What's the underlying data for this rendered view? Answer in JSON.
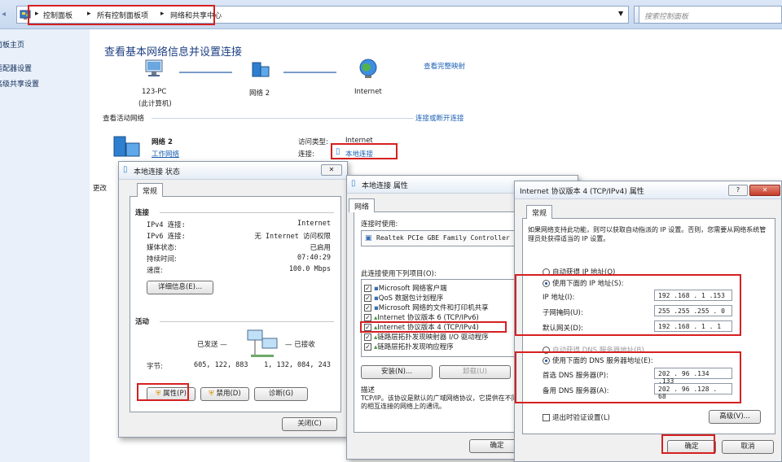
{
  "address_bar": {
    "crumbs": [
      "控制面板",
      "所有控制面板项",
      "网络和共享中心"
    ],
    "search_placeholder": "搜索控制面板"
  },
  "left_nav": [
    "控制面板主页",
    "更改适配器设置",
    "更改高级共享设置"
  ],
  "main": {
    "title": "查看基本网络信息并设置连接",
    "view_full_map": "查看完整映射",
    "node_pc": "123-PC",
    "node_pc_sub": "(此计算机)",
    "node_network": "网络  2",
    "node_internet": "Internet",
    "active_networks_label": "查看活动网络",
    "connect_disconnect": "连接或断开连接",
    "network_name": "网络  2",
    "network_type": "工作网络",
    "access_type_label": "访问类型:",
    "access_type_value": "Internet",
    "connection_label": "连接:",
    "connection_value": "本地连接",
    "change_label": "更改"
  },
  "status_dialog": {
    "title": "本地连接 状态",
    "close_x": "✕",
    "tab": "常规",
    "connection_header": "连接",
    "rows": [
      {
        "label": "IPv4 连接:",
        "value": "Internet"
      },
      {
        "label": "IPv6 连接:",
        "value": "无 Internet 访问权限"
      },
      {
        "label": "媒体状态:",
        "value": "已启用"
      },
      {
        "label": "持续时间:",
        "value": "07:40:29"
      },
      {
        "label": "速度:",
        "value": "100.0 Mbps"
      }
    ],
    "details_button": "详细信息(E)...",
    "activity_header": "活动",
    "sent_label": "已发送 —",
    "received_label": "— 已接收",
    "bytes_label": "字节:",
    "bytes_sent": "605, 122, 883",
    "bytes_received": "1, 132, 084, 243",
    "properties_button": "属性(P)",
    "disable_button": "禁用(D)",
    "diagnose_button": "诊断(G)",
    "close_button": "关闭(C)"
  },
  "props_dialog": {
    "title": "本地连接 属性",
    "tab": "网络",
    "connect_using_label": "连接时使用:",
    "adapter": "Realtek PCIe GBE Family Controller",
    "configure_stub": "配",
    "items_label": "此连接使用下列项目(O):",
    "items": [
      "Microsoft 网络客户端",
      "QoS 数据包计划程序",
      "Microsoft 网络的文件和打印机共享",
      "Internet 协议版本 6 (TCP/IPv6)",
      "Internet 协议版本 4 (TCP/IPv4)",
      "链路层拓扑发现映射器 I/O 驱动程序",
      "链路层拓扑发现响应程序"
    ],
    "install_button": "安装(N)...",
    "uninstall_button": "卸载(U)",
    "description_header": "描述",
    "description": "TCP/IP。该协议是默认的广域网络协议，它提供在不同的相互连接的网络上的通讯。",
    "ok_button": "确定"
  },
  "ipv4_dialog": {
    "title": "Internet 协议版本 4 (TCP/IPv4) 属性",
    "help_icon": "?",
    "close_icon": "✕",
    "tab": "常规",
    "intro": "如果网络支持此功能，则可以获取自动指派的 IP 设置。否则，您需要从网络系统管理员处获得适当的 IP 设置。",
    "auto_ip": "自动获得 IP 地址(O)",
    "manual_ip": "使用下面的 IP 地址(S):",
    "ip_label": "IP 地址(I):",
    "ip_value": "192 .168 . 1  .153",
    "mask_label": "子网掩码(U):",
    "mask_value": "255 .255 .255 . 0",
    "gateway_label": "默认网关(D):",
    "gateway_value": "192 .168 . 1  . 1",
    "auto_dns": "自动获得 DNS 服务器地址(B)",
    "manual_dns": "使用下面的 DNS 服务器地址(E):",
    "dns1_label": "首选 DNS 服务器(P):",
    "dns1_value": "202 . 96 .134 .133",
    "dns2_label": "备用 DNS 服务器(A):",
    "dns2_value": "202 . 96 .128 . 68",
    "validate_label": "退出时验证设置(L)",
    "advanced_button": "高级(V)...",
    "ok_button": "确定",
    "cancel_button": "取消"
  }
}
